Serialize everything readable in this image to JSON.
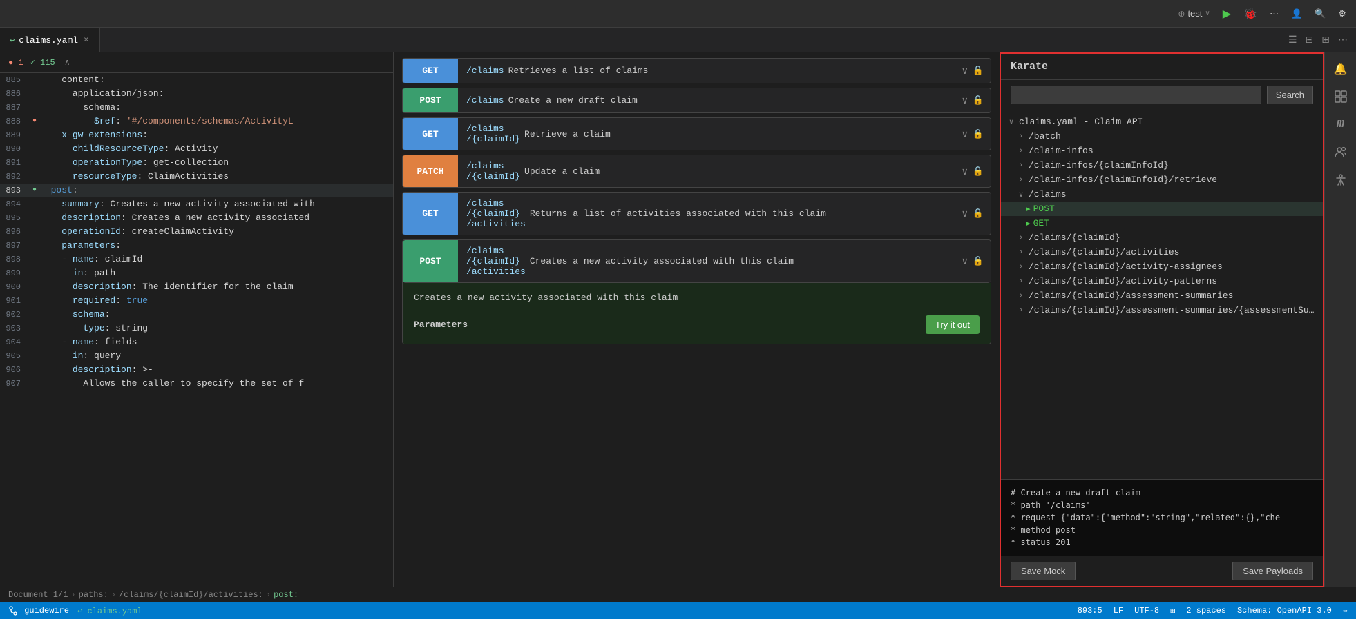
{
  "topbar": {
    "run_config": "test",
    "run_label": "▶",
    "bug_label": "🐞",
    "more_label": "⋯",
    "user_icon": "👤",
    "search_icon": "🔍",
    "settings_icon": "⚙"
  },
  "tab": {
    "file_icon": "↩",
    "filename": "claims.yaml",
    "close_icon": "×"
  },
  "error_bar": {
    "error_count": "● 1",
    "ok_count": "✓ 115",
    "expand": "∧"
  },
  "editor": {
    "lines": [
      {
        "num": "885",
        "content": "    content:"
      },
      {
        "num": "886",
        "content": "      application/json:"
      },
      {
        "num": "887",
        "content": "        schema:"
      },
      {
        "num": "888",
        "content": "          $ref: '#/components/schemas/ActivityL"
      },
      {
        "num": "889",
        "content": "    x-gw-extensions:"
      },
      {
        "num": "890",
        "content": "      childResourceType: Activity"
      },
      {
        "num": "891",
        "content": "      operationType: get-collection"
      },
      {
        "num": "892",
        "content": "      resourceType: ClaimActivities"
      },
      {
        "num": "893",
        "content": "  post:",
        "active": true
      },
      {
        "num": "894",
        "content": "    summary: Creates a new activity associated with"
      },
      {
        "num": "895",
        "content": "    description: Creates a new activity associated"
      },
      {
        "num": "896",
        "content": "    operationId: createClaimActivity"
      },
      {
        "num": "897",
        "content": "    parameters:"
      },
      {
        "num": "898",
        "content": "    - name: claimId"
      },
      {
        "num": "899",
        "content": "      in: path"
      },
      {
        "num": "900",
        "content": "      description: The identifier for the claim"
      },
      {
        "num": "901",
        "content": "      required: true"
      },
      {
        "num": "902",
        "content": "      schema:"
      },
      {
        "num": "903",
        "content": "        type: string"
      },
      {
        "num": "904",
        "content": "    - name: fields"
      },
      {
        "num": "905",
        "content": "      in: query"
      },
      {
        "num": "906",
        "content": "      description: >-"
      },
      {
        "num": "907",
        "content": "        Allows the caller to specify the set of f"
      }
    ]
  },
  "api_panel": {
    "endpoints": [
      {
        "method": "GET",
        "path": "/claims",
        "desc": "Retrieves a list of claims",
        "expanded": false
      },
      {
        "method": "POST",
        "path": "/claims",
        "desc": "Create a new draft claim",
        "expanded": false
      },
      {
        "method": "GET",
        "path": "/claims\n/{claimId}",
        "desc": "Retrieve a claim",
        "expanded": false
      },
      {
        "method": "PATCH",
        "path": "/claims\n/{claimId}",
        "desc": "Update a claim",
        "expanded": false
      },
      {
        "method": "GET",
        "path": "/claims\n/{claimId}\n/activities",
        "desc": "Returns a list of activities associated with this claim",
        "expanded": false
      }
    ],
    "expanded_endpoint": {
      "method": "POST",
      "path": "/claims\n/{claimId}\n/activities",
      "desc": "Creates a new activity associated with this claim",
      "description_body": "Creates a new activity associated with this claim",
      "params_label": "Parameters",
      "try_label": "Try it out"
    }
  },
  "karate": {
    "title": "Karate",
    "search_placeholder": "",
    "search_btn": "Search",
    "tree": {
      "root_label": "claims.yaml - Claim API",
      "items": [
        {
          "label": "/batch",
          "indent": 1,
          "chevron": "›",
          "expanded": false
        },
        {
          "label": "/claim-infos",
          "indent": 1,
          "chevron": "›",
          "expanded": false
        },
        {
          "label": "/claim-infos/{claimInfoId}",
          "indent": 1,
          "chevron": "›",
          "expanded": false
        },
        {
          "label": "/claim-infos/{claimInfoId}/retrieve",
          "indent": 1,
          "chevron": "›",
          "expanded": false
        },
        {
          "label": "/claims",
          "indent": 1,
          "chevron": "∨",
          "expanded": true
        },
        {
          "label": "POST",
          "indent": 2,
          "run_icon": "▶",
          "active": true
        },
        {
          "label": "GET",
          "indent": 2,
          "run_icon": "▶"
        },
        {
          "label": "/claims/{claimId}",
          "indent": 1,
          "chevron": "›",
          "expanded": false
        },
        {
          "label": "/claims/{claimId}/activities",
          "indent": 1,
          "chevron": "›",
          "expanded": false
        },
        {
          "label": "/claims/{claimId}/activity-assignees",
          "indent": 1,
          "chevron": "›",
          "expanded": false
        },
        {
          "label": "/claims/{claimId}/activity-patterns",
          "indent": 1,
          "chevron": "›",
          "expanded": false
        },
        {
          "label": "/claims/{claimId}/assessment-summaries",
          "indent": 1,
          "chevron": "›",
          "expanded": false
        },
        {
          "label": "/claims/{claimId}/assessment-summaries/{assessmentSumm",
          "indent": 1,
          "chevron": "›",
          "expanded": false
        }
      ]
    },
    "code": "# Create a new draft claim\n* path '/claims'\n* request {\"data\":{\"method\":\"string\",\"related\":{},\"che\n* method post\n* status 201",
    "save_mock_btn": "Save Mock",
    "save_payloads_btn": "Save Payloads"
  },
  "right_sidebar": {
    "icons": [
      "🔔",
      "⊞",
      "m",
      "👥",
      "≡"
    ]
  },
  "statusbar": {
    "left": [
      {
        "label": "Document 1/1"
      },
      {
        "sep": "›"
      },
      {
        "label": "paths:"
      },
      {
        "sep": "›"
      },
      {
        "label": "/claims/{claimId}/activities:"
      },
      {
        "sep": "›"
      },
      {
        "label": "post:"
      }
    ],
    "right": [
      {
        "label": "893:5"
      },
      {
        "label": "LF"
      },
      {
        "label": "UTF-8"
      },
      {
        "label": "⊞"
      },
      {
        "label": "2 spaces"
      },
      {
        "label": "Schema: OpenAPI 3.0"
      },
      {
        "label": "⇔"
      }
    ]
  }
}
